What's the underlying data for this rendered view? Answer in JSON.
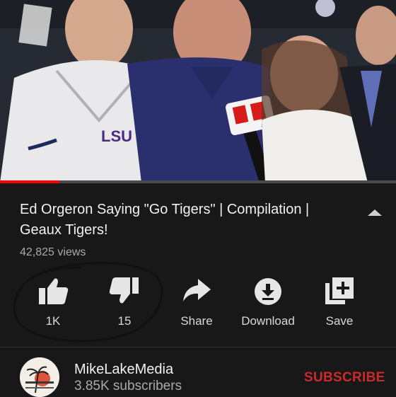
{
  "video": {
    "badge_text": "E",
    "jacket_text": "LSU",
    "progress_percent": 15
  },
  "details": {
    "title": "Ed Orgeron Saying \"Go Tigers\" | Compilation | Geaux Tigers!",
    "views": "42,825 views"
  },
  "actions": [
    {
      "label": "1K",
      "icon": "thumbs-up-icon"
    },
    {
      "label": "15",
      "icon": "thumbs-down-icon"
    },
    {
      "label": "Share",
      "icon": "share-icon"
    },
    {
      "label": "Download",
      "icon": "download-icon"
    },
    {
      "label": "Save",
      "icon": "save-icon"
    }
  ],
  "channel": {
    "name": "MikeLakeMedia",
    "subscribers": "3.85K subscribers",
    "subscribe_label": "SUBSCRIBE"
  },
  "colors": {
    "background": "#181818",
    "subscribe": "#cc2a2a",
    "progress": "#ff0000"
  }
}
